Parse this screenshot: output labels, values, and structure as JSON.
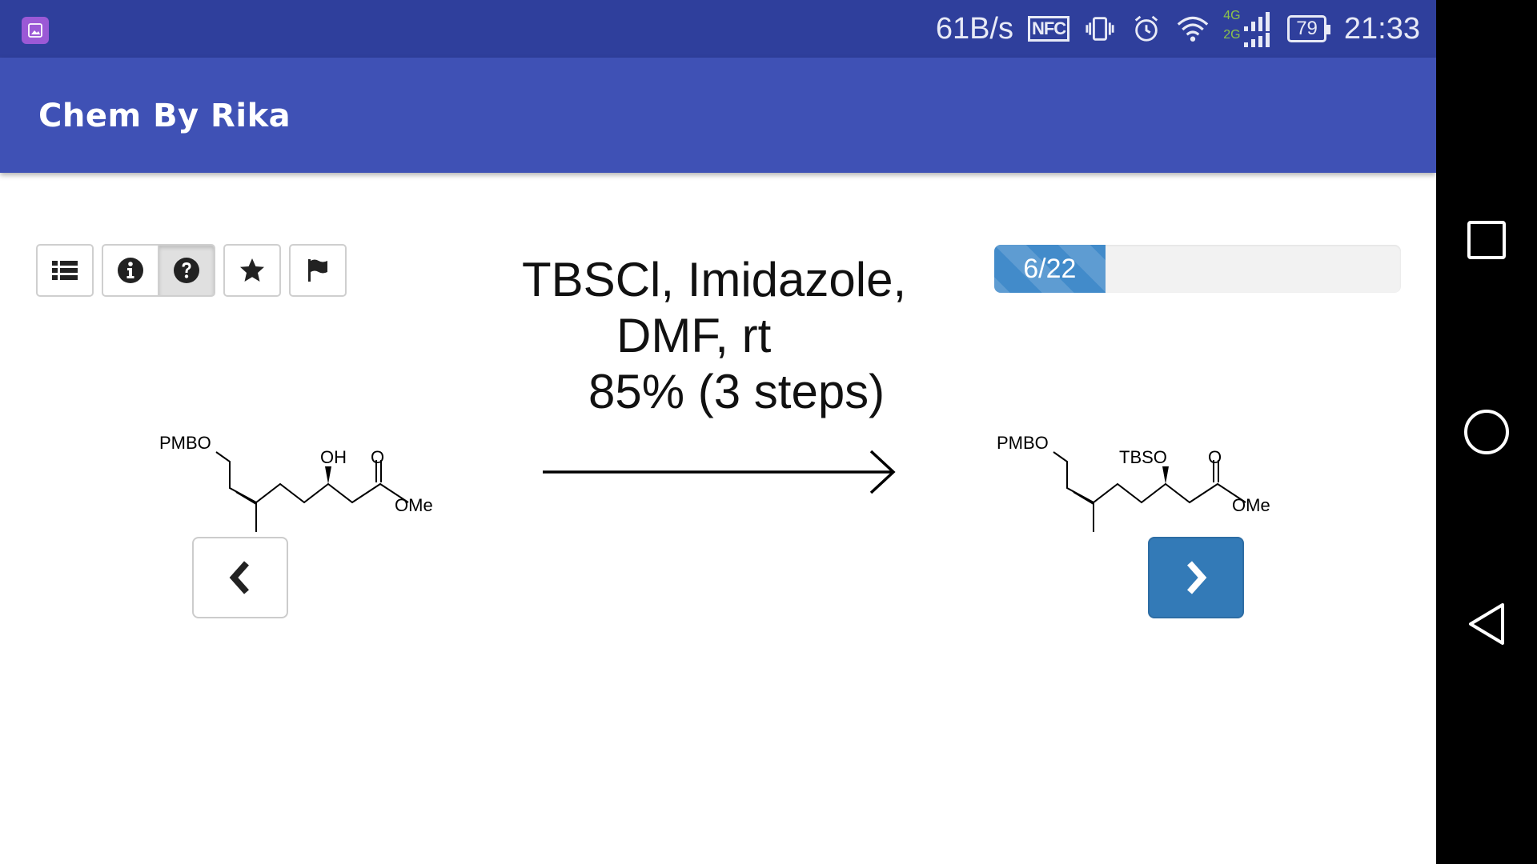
{
  "status_bar": {
    "net_speed": "61B/s",
    "nfc_label": "NFC",
    "signal_4g": "4G",
    "signal_2g": "2G",
    "battery": "79",
    "time": "21:33",
    "icons": [
      "gallery-notification-icon",
      "nfc-icon",
      "vibrate-icon",
      "alarm-icon",
      "wifi-icon",
      "signal-icon",
      "battery-icon"
    ]
  },
  "appbar": {
    "title": "Chem By Rika"
  },
  "toolbar": {
    "buttons": [
      {
        "icon": "list-icon",
        "active": false
      },
      {
        "icon": "info-icon",
        "active": false
      },
      {
        "icon": "question-icon",
        "active": true
      },
      {
        "icon": "star-icon",
        "active": false
      },
      {
        "icon": "flag-icon",
        "active": false
      }
    ]
  },
  "reaction": {
    "conditions_line1": "TBSCl, Imidazole,",
    "conditions_line2": "DMF, rt",
    "yield": "85% (3 steps)"
  },
  "progress": {
    "label": "6/22",
    "current": 6,
    "total": 22
  },
  "reactant": {
    "pmbo": "PMBO",
    "oh": "OH",
    "carbonyl_o": "O",
    "ome": "OMe"
  },
  "product": {
    "pmbo": "PMBO",
    "tbso": "TBSO",
    "carbonyl_o": "O",
    "ome": "OMe"
  },
  "colors": {
    "status_bar": "#2f3f9c",
    "app_bar": "#3f51b5",
    "progress_fill": "#428bca",
    "next_button": "#337ab7"
  }
}
